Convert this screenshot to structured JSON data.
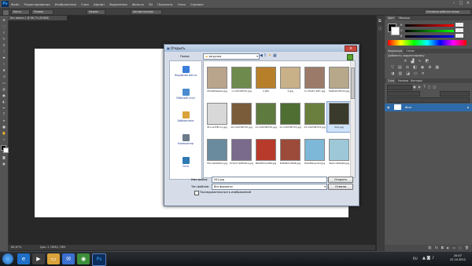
{
  "app": {
    "logo": "Ps"
  },
  "menu": {
    "items": [
      "Файл",
      "Редактирование",
      "Изображение",
      "Слои",
      "Шрифт",
      "Выделение",
      "Фильтр",
      "3D",
      "Просмотр",
      "Окно",
      "Справка"
    ]
  },
  "options": {
    "mode_label": "Кисть",
    "size_label": "Размер",
    "opacity_label": "Нажим",
    "auto_label": "Автоматизация",
    "search_field": "Основная рабочая среда"
  },
  "document": {
    "tab_title": "Без имени-1 @ 66.7% (RGB/8)",
    "zoom": "66,67%",
    "doc_info": "Док: 2,78M/2,78M"
  },
  "panels": {
    "color_tabs": [
      "Цвет",
      "Образцы"
    ],
    "correction_tabs": [
      "Коррекция",
      "Стили"
    ],
    "correction_title": "Добавить корректировку",
    "layers_tabs": [
      "Слои",
      "Каналы",
      "Контуры"
    ],
    "layer_name": "Фон"
  },
  "dialog": {
    "title": "Открыть",
    "lookin_label": "Папка:",
    "current_folder": "загрузки",
    "places": [
      {
        "label": "Недавние места",
        "color": "#3b7dd8"
      },
      {
        "label": "Рабочий стол",
        "color": "#4a8ccf"
      },
      {
        "label": "Библиотеки",
        "color": "#d9a23a"
      },
      {
        "label": "Компьютер",
        "color": "#6c7a8a"
      },
      {
        "label": "Сеть",
        "color": "#2f7ab5"
      }
    ],
    "files": [
      {
        "name": "0f1e829e4e4.jpg",
        "color": "#b9a58c"
      },
      {
        "name": "1.130708732.jpg",
        "color": "#6e8a4d"
      },
      {
        "name": "2.JPG",
        "color": "#b87f2a"
      },
      {
        "name": "3.jpg",
        "color": "#c8b089"
      },
      {
        "name": "3.c3545c 90fc.jpg",
        "color": "#9c7a6a"
      },
      {
        "name": "5a6049765dd.jpg",
        "color": "#b7a88c"
      },
      {
        "name": "8f+1e7f8c11.jpg",
        "color": "#d8d8d8"
      },
      {
        "name": "10.130708732.jpg",
        "color": "#7a5c3a"
      },
      {
        "name": "11.130708732.jpg",
        "color": "#5e7a3e"
      },
      {
        "name": "11.130708733.jpg",
        "color": "#4e6e32"
      },
      {
        "name": "13.130708733.jpg",
        "color": "#6a7e3e"
      },
      {
        "name": "041.jpg",
        "color": "#3a3a2c"
      },
      {
        "name": "55cca6d4612.jpg",
        "color": "#6a8a9e"
      },
      {
        "name": "672e7c498391e.jpg",
        "color": "#7a6a8c"
      },
      {
        "name": "86d5831ed89.jpg",
        "color": "#b83a2a"
      },
      {
        "name": "8d56827a898.jpg",
        "color": "#9c4a3a"
      },
      {
        "name": "8d4d82eac6d.jpg",
        "color": "#7eb8d8"
      },
      {
        "name": "36e7c499e6b.jpg",
        "color": "#9ec8d8"
      }
    ],
    "filename_label": "Имя файла:",
    "filename_value": "041.jpg",
    "filetype_label": "Тип файлов:",
    "filetype_value": "Все форматы",
    "open_button": "Открыть",
    "cancel_button": "Отмена",
    "sequence_label": "Последовательность изображений"
  },
  "taskbar": {
    "time": "20:07",
    "date": "22.10.2012",
    "lang": "RU"
  }
}
